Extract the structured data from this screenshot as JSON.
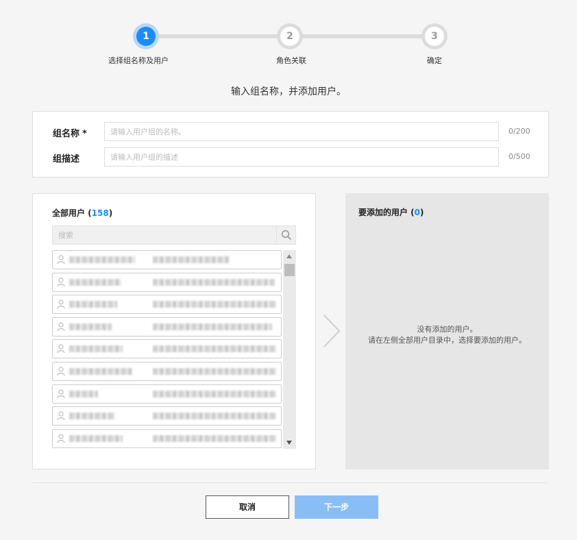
{
  "stepper": {
    "steps": [
      {
        "number": "1",
        "label": "选择组名称及用户",
        "active": true
      },
      {
        "number": "2",
        "label": "角色关联",
        "active": false
      },
      {
        "number": "3",
        "label": "确定",
        "active": false
      }
    ]
  },
  "intro_text": "输入组名称，并添加用户。",
  "form": {
    "name_label": "组名称",
    "required_mark": "*",
    "name_placeholder": "请输入用户组的名称。",
    "name_count": "0/200",
    "desc_label": "组描述",
    "desc_placeholder": "请输入用户组的描述",
    "desc_count": "0/500"
  },
  "all_users": {
    "title_prefix": "全部用户 (",
    "count": "158",
    "title_suffix": ")",
    "search_placeholder": "搜索",
    "visible_rows": 9
  },
  "selected_users": {
    "title_prefix": "要添加的用户 (",
    "count": "0",
    "title_suffix": ")",
    "empty_line1": "没有添加的用户。",
    "empty_line2": "请在左侧全部用户目录中，选择要添加的用户。"
  },
  "buttons": {
    "cancel": "取消",
    "next": "下一步"
  },
  "colors": {
    "accent": "#1a8cff",
    "next_disabled": "#89bdf6"
  }
}
